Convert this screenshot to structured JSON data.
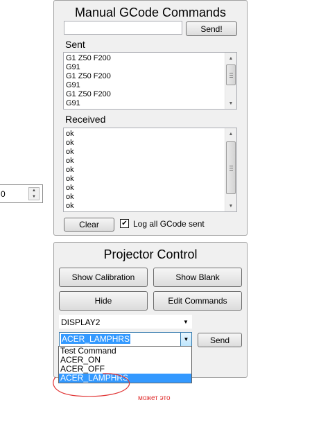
{
  "manual_gcode": {
    "title": "Manual GCode Commands",
    "command_input_value": "",
    "send_button": "Send!",
    "sent_label": "Sent",
    "sent_lines": [
      "G1 Z50 F200",
      "G91",
      "G1 Z50 F200",
      "G91",
      "G1 Z50 F200",
      "G91"
    ],
    "received_label": "Received",
    "received_lines": [
      "ok",
      "ok",
      "ok",
      "ok",
      "ok",
      "ok",
      "ok",
      "ok",
      "ok"
    ],
    "clear_button": "Clear",
    "log_checkbox_label": "Log all GCode sent",
    "log_checked": true
  },
  "left_spinner": {
    "value": "0"
  },
  "projector_control": {
    "title": "Projector Control",
    "show_calibration_button": "Show Calibration",
    "show_blank_button": "Show Blank",
    "hide_button": "Hide",
    "edit_commands_button": "Edit Commands",
    "display_select_value": "DISPLAY2",
    "command_select_value": "ACER_LAMPHRS",
    "send_button": "Send",
    "command_options": [
      "Test Command",
      "ACER_ON",
      "ACER_OFF",
      "ACER_LAMPHRS"
    ],
    "selected_option_index": 3
  },
  "annotation": {
    "note_text": "может это",
    "color": "#e03030"
  },
  "colors": {
    "panel_bg": "#f0f0f0",
    "selection": "#3399ff"
  }
}
